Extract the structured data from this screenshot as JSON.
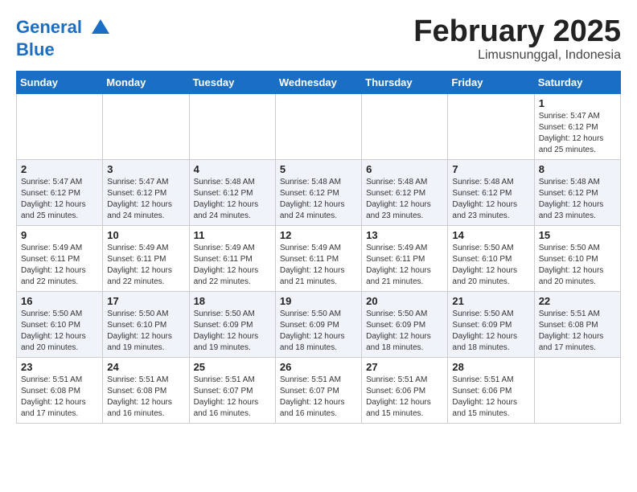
{
  "header": {
    "logo_line1": "General",
    "logo_line2": "Blue",
    "title": "February 2025",
    "subtitle": "Limusnunggal, Indonesia"
  },
  "weekdays": [
    "Sunday",
    "Monday",
    "Tuesday",
    "Wednesday",
    "Thursday",
    "Friday",
    "Saturday"
  ],
  "weeks": [
    [
      {
        "day": "",
        "info": ""
      },
      {
        "day": "",
        "info": ""
      },
      {
        "day": "",
        "info": ""
      },
      {
        "day": "",
        "info": ""
      },
      {
        "day": "",
        "info": ""
      },
      {
        "day": "",
        "info": ""
      },
      {
        "day": "1",
        "info": "Sunrise: 5:47 AM\nSunset: 6:12 PM\nDaylight: 12 hours\nand 25 minutes."
      }
    ],
    [
      {
        "day": "2",
        "info": "Sunrise: 5:47 AM\nSunset: 6:12 PM\nDaylight: 12 hours\nand 25 minutes."
      },
      {
        "day": "3",
        "info": "Sunrise: 5:47 AM\nSunset: 6:12 PM\nDaylight: 12 hours\nand 24 minutes."
      },
      {
        "day": "4",
        "info": "Sunrise: 5:48 AM\nSunset: 6:12 PM\nDaylight: 12 hours\nand 24 minutes."
      },
      {
        "day": "5",
        "info": "Sunrise: 5:48 AM\nSunset: 6:12 PM\nDaylight: 12 hours\nand 24 minutes."
      },
      {
        "day": "6",
        "info": "Sunrise: 5:48 AM\nSunset: 6:12 PM\nDaylight: 12 hours\nand 23 minutes."
      },
      {
        "day": "7",
        "info": "Sunrise: 5:48 AM\nSunset: 6:12 PM\nDaylight: 12 hours\nand 23 minutes."
      },
      {
        "day": "8",
        "info": "Sunrise: 5:48 AM\nSunset: 6:12 PM\nDaylight: 12 hours\nand 23 minutes."
      }
    ],
    [
      {
        "day": "9",
        "info": "Sunrise: 5:49 AM\nSunset: 6:11 PM\nDaylight: 12 hours\nand 22 minutes."
      },
      {
        "day": "10",
        "info": "Sunrise: 5:49 AM\nSunset: 6:11 PM\nDaylight: 12 hours\nand 22 minutes."
      },
      {
        "day": "11",
        "info": "Sunrise: 5:49 AM\nSunset: 6:11 PM\nDaylight: 12 hours\nand 22 minutes."
      },
      {
        "day": "12",
        "info": "Sunrise: 5:49 AM\nSunset: 6:11 PM\nDaylight: 12 hours\nand 21 minutes."
      },
      {
        "day": "13",
        "info": "Sunrise: 5:49 AM\nSunset: 6:11 PM\nDaylight: 12 hours\nand 21 minutes."
      },
      {
        "day": "14",
        "info": "Sunrise: 5:50 AM\nSunset: 6:10 PM\nDaylight: 12 hours\nand 20 minutes."
      },
      {
        "day": "15",
        "info": "Sunrise: 5:50 AM\nSunset: 6:10 PM\nDaylight: 12 hours\nand 20 minutes."
      }
    ],
    [
      {
        "day": "16",
        "info": "Sunrise: 5:50 AM\nSunset: 6:10 PM\nDaylight: 12 hours\nand 20 minutes."
      },
      {
        "day": "17",
        "info": "Sunrise: 5:50 AM\nSunset: 6:10 PM\nDaylight: 12 hours\nand 19 minutes."
      },
      {
        "day": "18",
        "info": "Sunrise: 5:50 AM\nSunset: 6:09 PM\nDaylight: 12 hours\nand 19 minutes."
      },
      {
        "day": "19",
        "info": "Sunrise: 5:50 AM\nSunset: 6:09 PM\nDaylight: 12 hours\nand 18 minutes."
      },
      {
        "day": "20",
        "info": "Sunrise: 5:50 AM\nSunset: 6:09 PM\nDaylight: 12 hours\nand 18 minutes."
      },
      {
        "day": "21",
        "info": "Sunrise: 5:50 AM\nSunset: 6:09 PM\nDaylight: 12 hours\nand 18 minutes."
      },
      {
        "day": "22",
        "info": "Sunrise: 5:51 AM\nSunset: 6:08 PM\nDaylight: 12 hours\nand 17 minutes."
      }
    ],
    [
      {
        "day": "23",
        "info": "Sunrise: 5:51 AM\nSunset: 6:08 PM\nDaylight: 12 hours\nand 17 minutes."
      },
      {
        "day": "24",
        "info": "Sunrise: 5:51 AM\nSunset: 6:08 PM\nDaylight: 12 hours\nand 16 minutes."
      },
      {
        "day": "25",
        "info": "Sunrise: 5:51 AM\nSunset: 6:07 PM\nDaylight: 12 hours\nand 16 minutes."
      },
      {
        "day": "26",
        "info": "Sunrise: 5:51 AM\nSunset: 6:07 PM\nDaylight: 12 hours\nand 16 minutes."
      },
      {
        "day": "27",
        "info": "Sunrise: 5:51 AM\nSunset: 6:06 PM\nDaylight: 12 hours\nand 15 minutes."
      },
      {
        "day": "28",
        "info": "Sunrise: 5:51 AM\nSunset: 6:06 PM\nDaylight: 12 hours\nand 15 minutes."
      },
      {
        "day": "",
        "info": ""
      }
    ]
  ]
}
